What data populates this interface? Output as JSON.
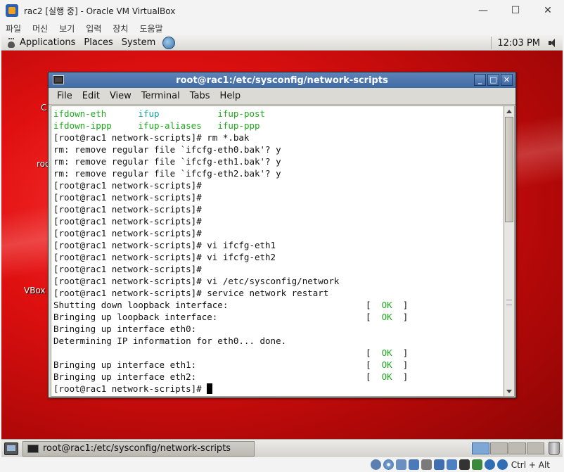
{
  "host_window": {
    "title": "rac2 [실행 중] - Oracle VM VirtualBox",
    "controls": {
      "minimize": "—",
      "maximize": "☐",
      "close": "✕"
    },
    "menu": [
      "파일",
      "머신",
      "보기",
      "입력",
      "장치",
      "도움말"
    ],
    "status_bar": {
      "host_key": "Ctrl + Alt"
    }
  },
  "top_panel": {
    "menus": [
      "Applications",
      "Places",
      "System"
    ],
    "clock": "12:03 PM"
  },
  "desktop_labels": [
    "C",
    "roo",
    "VBox"
  ],
  "terminal": {
    "title": "root@rac1:/etc/sysconfig/network-scripts",
    "menu": [
      "File",
      "Edit",
      "View",
      "Terminal",
      "Tabs",
      "Help"
    ],
    "controls": {
      "minimize": "_",
      "maximize": "□",
      "close": "✕"
    },
    "lines": [
      {
        "segments": [
          {
            "text": "ifdown-eth      ",
            "color": "green"
          },
          {
            "text": "ifup           ",
            "color": "cyan"
          },
          {
            "text": "ifup-post",
            "color": "green"
          }
        ]
      },
      {
        "segments": [
          {
            "text": "ifdown-ippp     ",
            "color": "green"
          },
          {
            "text": "ifup-aliases   ",
            "color": "green"
          },
          {
            "text": "ifup-ppp",
            "color": "green"
          }
        ]
      },
      {
        "text": "[root@rac1 network-scripts]# rm *.bak"
      },
      {
        "text": "rm: remove regular file `ifcfg-eth0.bak'? y"
      },
      {
        "text": "rm: remove regular file `ifcfg-eth1.bak'? y"
      },
      {
        "text": "rm: remove regular file `ifcfg-eth2.bak'? y"
      },
      {
        "text": "[root@rac1 network-scripts]#"
      },
      {
        "text": "[root@rac1 network-scripts]#"
      },
      {
        "text": "[root@rac1 network-scripts]#"
      },
      {
        "text": "[root@rac1 network-scripts]#"
      },
      {
        "text": "[root@rac1 network-scripts]#"
      },
      {
        "text": "[root@rac1 network-scripts]# vi ifcfg-eth1"
      },
      {
        "text": "[root@rac1 network-scripts]# vi ifcfg-eth2"
      },
      {
        "text": "[root@rac1 network-scripts]#"
      },
      {
        "text": "[root@rac1 network-scripts]# vi /etc/sysconfig/network"
      },
      {
        "text": "[root@rac1 network-scripts]# service network restart"
      },
      {
        "text": "Shutting down loopback interface:",
        "ok": true
      },
      {
        "text": "Bringing up loopback interface:",
        "ok": true
      },
      {
        "text": "Bringing up interface eth0:"
      },
      {
        "text": "Determining IP information for eth0... done."
      },
      {
        "text": "",
        "ok": true
      },
      {
        "text": "Bringing up interface eth1:",
        "ok": true
      },
      {
        "text": "Bringing up interface eth2:",
        "ok": true
      },
      {
        "text": "[root@rac1 network-scripts]# ",
        "cursor": true
      }
    ],
    "ok_label": "OK"
  },
  "bottom_panel": {
    "taskbar_item": "root@rac1:/etc/sysconfig/network-scripts",
    "workspaces": 4,
    "active_workspace": 1
  },
  "colors": {
    "green": "#1ea81e",
    "cyan": "#15a0a0",
    "titlebar": "#4a74ad",
    "desktop": "#e01010"
  }
}
